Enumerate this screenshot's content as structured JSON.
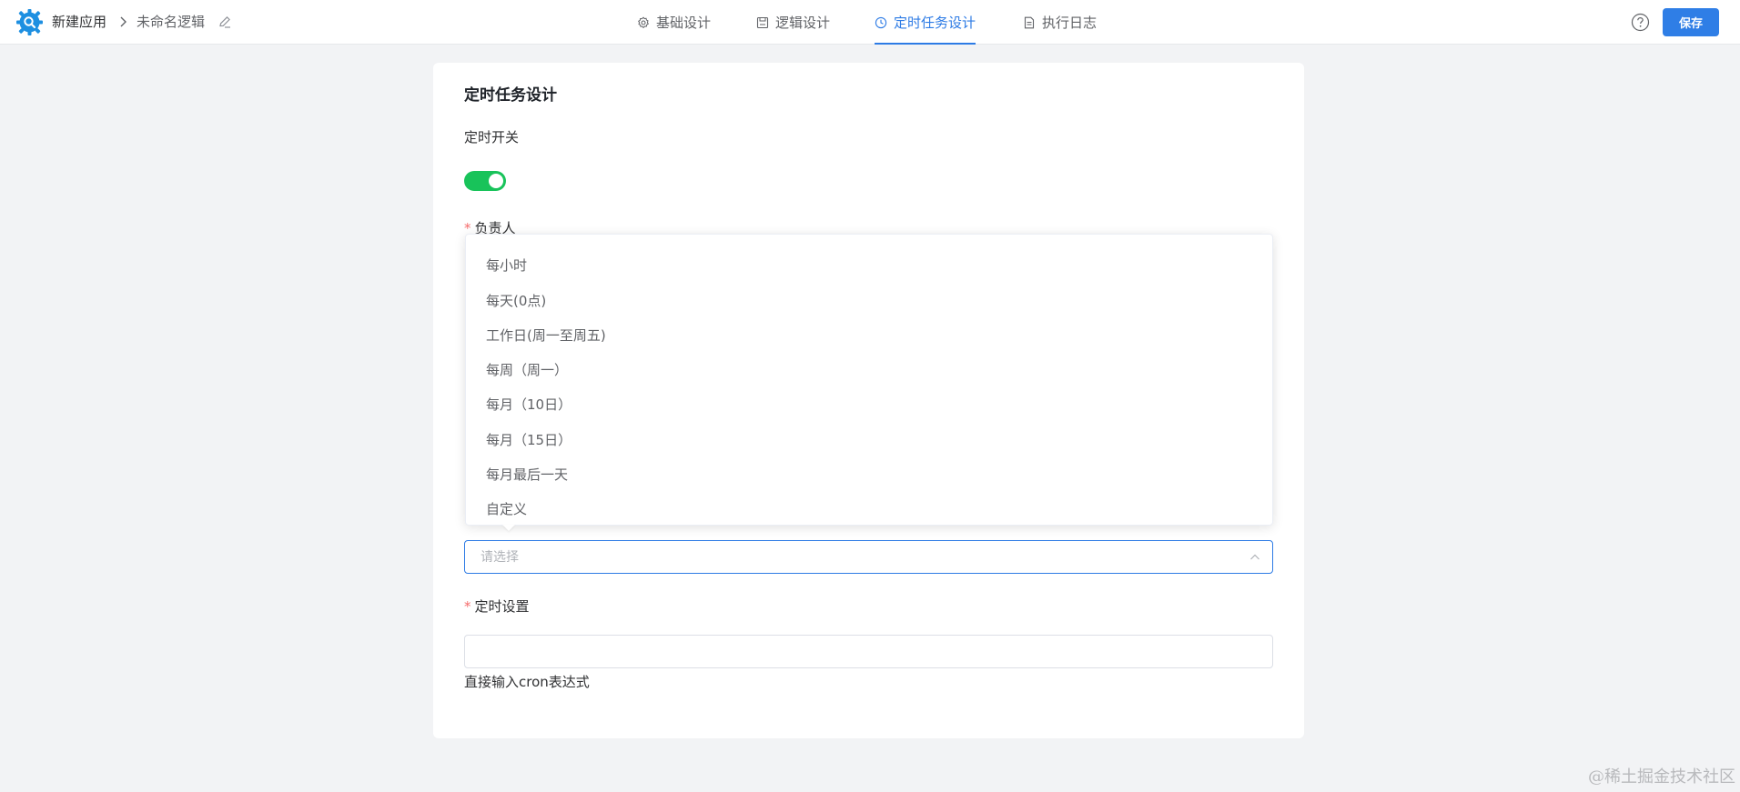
{
  "header": {
    "app_name": "新建应用",
    "logic_name": "未命名逻辑",
    "save_label": "保存"
  },
  "nav": {
    "tabs": [
      {
        "label": "基础设计",
        "icon": "gear-icon",
        "active": false
      },
      {
        "label": "逻辑设计",
        "icon": "document-save-icon",
        "active": false
      },
      {
        "label": "定时任务设计",
        "icon": "clock-icon",
        "active": true
      },
      {
        "label": "执行日志",
        "icon": "file-text-icon",
        "active": false
      }
    ]
  },
  "card": {
    "title": "定时任务设计",
    "switch_label": "定时开关",
    "switch_on": true,
    "owner_label": "负责人",
    "select_placeholder": "请选择",
    "schedule_label": "定时设置",
    "schedule_value": "",
    "hint": "直接输入cron表达式"
  },
  "dropdown": {
    "options": [
      "每小时",
      "每天(0点)",
      "工作日(周一至周五)",
      "每周（周一）",
      "每月（10日）",
      "每月（15日）",
      "每月最后一天",
      "自定义"
    ]
  },
  "watermark": "@稀土掘金技术社区",
  "colors": {
    "accent": "#2d7be5",
    "switch_on": "#18c35a",
    "required": "#f56c6c",
    "background": "#f2f3f5"
  }
}
